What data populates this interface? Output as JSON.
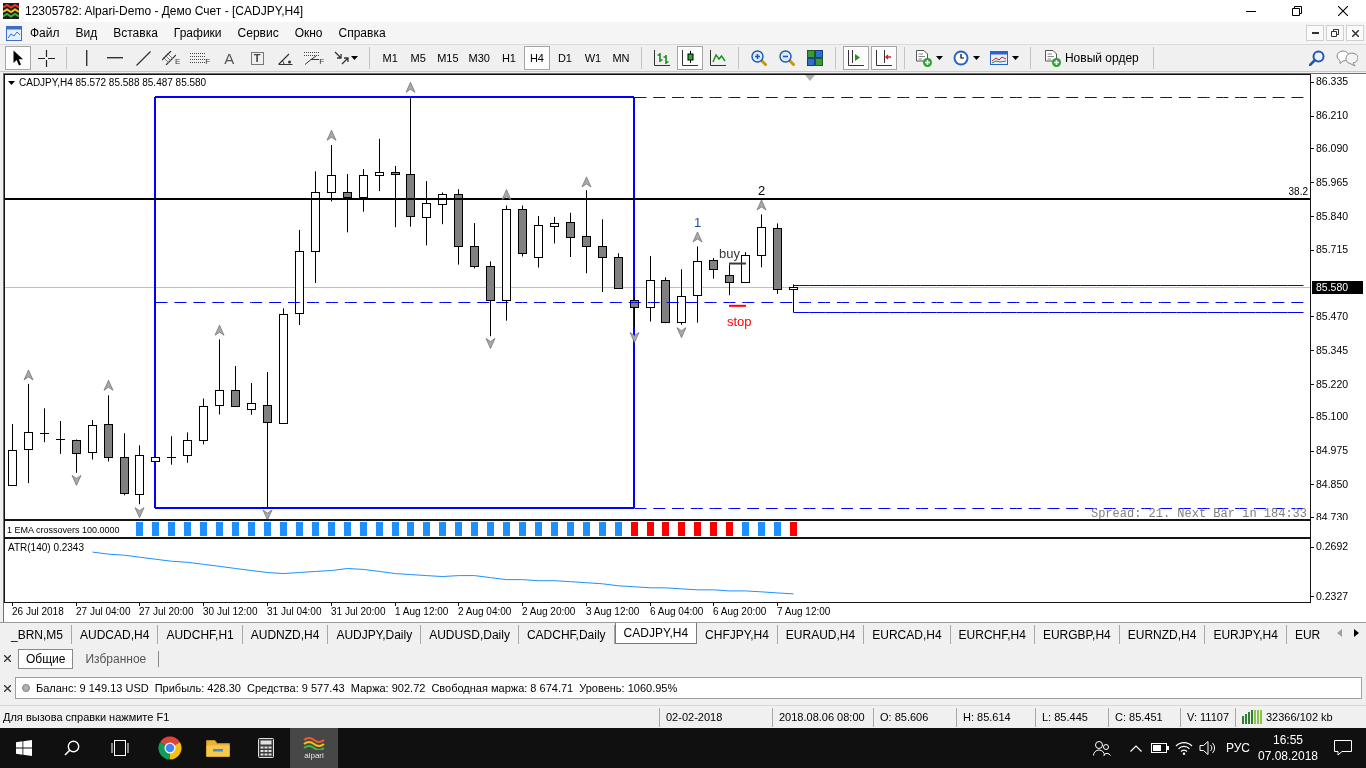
{
  "window": {
    "title": "12305782: Alpari-Demo - Демо Счет - [CADJPY,H4]"
  },
  "menu": [
    "Файл",
    "Вид",
    "Вставка",
    "Графики",
    "Сервис",
    "Окно",
    "Справка"
  ],
  "toolbar": {
    "draw_tools": [
      {
        "kind": "cursor",
        "selected": true
      },
      {
        "kind": "crosshair",
        "selected": false
      },
      {
        "kind": "vline",
        "selected": false
      },
      {
        "kind": "hline",
        "selected": false
      },
      {
        "kind": "trendline",
        "selected": false
      },
      {
        "kind": "channel",
        "glyph": "E",
        "selected": false
      },
      {
        "kind": "fibo",
        "glyph": "F",
        "selected": false
      },
      {
        "kind": "text",
        "glyph": "A",
        "selected": false
      },
      {
        "kind": "label",
        "glyph": "T",
        "selected": false
      },
      {
        "kind": "angle",
        "selected": false
      },
      {
        "kind": "fan",
        "glyph": "F",
        "selected": false
      },
      {
        "kind": "arrows",
        "selected": false
      }
    ],
    "timeframes": [
      {
        "label": "M1",
        "selected": false
      },
      {
        "label": "M5",
        "selected": false
      },
      {
        "label": "M15",
        "selected": false
      },
      {
        "label": "M30",
        "selected": false
      },
      {
        "label": "H1",
        "selected": false
      },
      {
        "label": "H4",
        "selected": true
      },
      {
        "label": "D1",
        "selected": false
      },
      {
        "label": "W1",
        "selected": false
      },
      {
        "label": "MN",
        "selected": false
      }
    ],
    "chart_types": [
      {
        "kind": "bars",
        "selected": false
      },
      {
        "kind": "candles",
        "selected": true
      },
      {
        "kind": "line",
        "selected": false
      }
    ],
    "view_tools": [
      {
        "kind": "zoom-in"
      },
      {
        "kind": "zoom-out"
      },
      {
        "kind": "tile"
      }
    ],
    "toggles": [
      {
        "kind": "autoscroll",
        "on": true
      },
      {
        "kind": "shift",
        "on": true
      }
    ],
    "menus": [
      {
        "kind": "indicators"
      },
      {
        "kind": "periods"
      },
      {
        "kind": "templates"
      }
    ],
    "new_order": "Новый ордер"
  },
  "chart": {
    "title": "CADJPY,H4 85.572 85.588 85.487 85.580",
    "chart_data": [
      {
        "type": "candlestick",
        "categories": [
          null,
          null,
          null,
          null,
          null,
          null,
          null,
          null,
          null,
          null,
          null,
          null,
          null,
          null,
          null,
          null,
          null,
          null,
          null,
          null,
          null,
          null,
          null,
          null,
          null,
          null,
          null,
          null,
          null,
          null,
          null,
          null,
          null,
          null,
          null,
          null,
          null,
          null,
          null,
          null,
          null,
          null,
          null,
          null,
          null,
          null,
          null,
          null,
          null,
          null,
          null,
          null,
          null,
          null,
          null,
          null,
          null,
          null,
          null,
          null,
          null,
          null,
          null,
          null,
          null,
          null,
          null,
          null,
          null,
          null,
          null,
          null,
          null,
          null,
          null,
          null,
          null,
          null,
          null,
          null,
          null,
          null
        ],
        "ohlc": [
          [
            84.848,
            85.073,
            84.845,
            84.976
          ],
          [
            84.98,
            85.221,
            84.855,
            85.042
          ],
          [
            85.038,
            85.131,
            85.006,
            85.04
          ],
          [
            85.018,
            85.084,
            84.963,
            85.018
          ],
          [
            85.013,
            85.016,
            84.893,
            84.965
          ],
          [
            84.968,
            85.088,
            84.942,
            85.069
          ],
          [
            85.072,
            85.179,
            84.935,
            84.95
          ],
          [
            84.95,
            85.039,
            84.81,
            84.817
          ],
          [
            84.814,
            84.994,
            84.777,
            84.96
          ],
          [
            84.936,
            84.953,
            84.936,
            84.953
          ],
          [
            84.949,
            85.028,
            84.923,
            84.951
          ],
          [
            84.957,
            85.042,
            84.93,
            85.013
          ],
          [
            85.013,
            85.167,
            84.998,
            85.141
          ],
          [
            85.144,
            85.385,
            85.108,
            85.197
          ],
          [
            85.197,
            85.287,
            85.138,
            85.138
          ],
          [
            85.129,
            85.224,
            85.107,
            85.149
          ],
          [
            85.144,
            85.265,
            84.765,
            85.079
          ],
          [
            85.078,
            85.5,
            85.073,
            85.48
          ],
          [
            85.483,
            85.789,
            85.438,
            85.71
          ],
          [
            85.71,
            86.005,
            85.593,
            85.927
          ],
          [
            85.929,
            86.102,
            85.894,
            85.992
          ],
          [
            85.927,
            85.995,
            85.78,
            85.909
          ],
          [
            85.909,
            86.013,
            85.856,
            85.991
          ],
          [
            85.991,
            86.125,
            85.932,
            86.003
          ],
          [
            86.003,
            86.025,
            85.799,
            85.995
          ],
          [
            85.995,
            86.275,
            85.801,
            85.84
          ],
          [
            85.835,
            85.969,
            85.732,
            85.887
          ],
          [
            85.885,
            85.927,
            85.81,
            85.921
          ],
          [
            85.92,
            85.939,
            85.661,
            85.728
          ],
          [
            85.728,
            85.814,
            85.647,
            85.656
          ],
          [
            85.656,
            85.673,
            85.397,
            85.531
          ],
          [
            85.531,
            85.879,
            85.454,
            85.866
          ],
          [
            85.866,
            85.879,
            85.691,
            85.703
          ],
          [
            85.689,
            85.84,
            85.65,
            85.807
          ],
          [
            85.804,
            85.837,
            85.739,
            85.813
          ],
          [
            85.817,
            85.852,
            85.689,
            85.763
          ],
          [
            85.766,
            85.935,
            85.629,
            85.728
          ],
          [
            85.728,
            85.828,
            85.56,
            85.688
          ],
          [
            85.688,
            85.703,
            85.573,
            85.576
          ],
          [
            85.53,
            85.54,
            85.431,
            85.505
          ],
          [
            85.504,
            85.693,
            85.451,
            85.606
          ],
          [
            85.606,
            85.614,
            85.445,
            85.451
          ],
          [
            85.451,
            85.644,
            85.439,
            85.544
          ],
          [
            85.549,
            85.728,
            85.447,
            85.676
          ],
          [
            85.679,
            85.685,
            85.609,
            85.646
          ],
          [
            85.623,
            85.662,
            85.548,
            85.597
          ],
          [
            85.597,
            85.707,
            85.593,
            85.697
          ],
          [
            85.697,
            85.846,
            85.651,
            85.799
          ],
          [
            85.795,
            85.813,
            85.553,
            85.57
          ],
          [
            85.572,
            85.588,
            85.487,
            85.58
          ],
          null,
          null,
          null,
          null,
          null,
          null,
          null,
          null,
          null,
          null,
          null,
          null,
          null,
          null,
          null,
          null,
          null,
          null,
          null,
          null,
          null,
          null,
          null,
          null,
          null,
          null,
          null,
          null,
          null,
          null,
          null,
          null
        ],
        "series": [
          {
            "type": "scatter",
            "marker": "diamond",
            "color": "#a9a9a9",
            "values": [
              null,
              85.254,
              null,
              null,
              null,
              null,
              85.216,
              null,
              null,
              null,
              null,
              null,
              null,
              85.419,
              null,
              null,
              null,
              null,
              null,
              null,
              86.138,
              null,
              null,
              null,
              null,
              86.315,
              null,
              null,
              null,
              null,
              null,
              85.919,
              null,
              null,
              null,
              null,
              85.966,
              null,
              null,
              null,
              null,
              null,
              null,
              85.763,
              null,
              null,
              null,
              85.881,
              null,
              null,
              null,
              null,
              null,
              null,
              null,
              null,
              null,
              null,
              null,
              null,
              null,
              null,
              null,
              null,
              null,
              null,
              null,
              null,
              null,
              null,
              null,
              null,
              null,
              null,
              null,
              null,
              null,
              null,
              null,
              null,
              null,
              null
            ]
          },
          {
            "type": "scatter",
            "marker": "diamond",
            "color": "#a9a9a9",
            "values": [
              null,
              null,
              null,
              null,
              84.865,
              null,
              null,
              null,
              84.746,
              null,
              null,
              null,
              null,
              null,
              null,
              null,
              84.737,
              null,
              null,
              null,
              null,
              null,
              null,
              null,
              null,
              null,
              null,
              null,
              null,
              null,
              85.37,
              null,
              null,
              null,
              null,
              null,
              null,
              null,
              null,
              85.392,
              null,
              null,
              85.41,
              null,
              null,
              null,
              null,
              null,
              null,
              null,
              null,
              null,
              null,
              null,
              null,
              null,
              null,
              null,
              null,
              null,
              null,
              null,
              null,
              null,
              null,
              null,
              null,
              null,
              null,
              null,
              null,
              null,
              null,
              null,
              null,
              null,
              null,
              null,
              null,
              null,
              null,
              null
            ]
          },
          {
            "type": "line",
            "color": "#0000ff",
            "values": [
              null,
              null,
              null,
              null,
              null,
              null,
              null,
              null,
              null,
              86.28,
              86.28,
              86.28,
              86.28,
              86.28,
              86.28,
              86.28,
              86.28,
              86.28,
              86.28,
              86.28,
              86.28,
              86.28,
              86.28,
              86.28,
              86.28,
              86.28,
              86.28,
              86.28,
              86.28,
              86.28,
              86.28,
              86.28,
              86.28,
              86.28,
              86.28,
              86.28,
              86.28,
              86.28,
              86.28,
              86.28,
              null,
              null,
              null,
              null,
              null,
              null,
              null,
              null,
              null,
              null,
              null,
              null,
              null,
              null,
              null,
              null,
              null,
              null,
              null,
              null,
              null,
              null,
              null,
              null,
              null,
              null,
              null,
              null,
              null,
              null,
              null,
              null,
              null,
              null,
              null,
              null,
              null,
              null,
              null,
              null,
              null,
              null
            ]
          },
          {
            "type": "line",
            "color": "#0000ff",
            "values": [
              null,
              null,
              null,
              null,
              null,
              null,
              null,
              null,
              null,
              84.762,
              84.762,
              84.762,
              84.762,
              84.762,
              84.762,
              84.762,
              84.762,
              84.762,
              84.762,
              84.762,
              84.762,
              84.762,
              84.762,
              84.762,
              84.762,
              84.762,
              84.762,
              84.762,
              84.762,
              84.762,
              84.762,
              84.762,
              84.762,
              84.762,
              84.762,
              84.762,
              84.762,
              84.762,
              84.762,
              84.762,
              null,
              null,
              null,
              null,
              null,
              null,
              null,
              null,
              null,
              null,
              null,
              null,
              null,
              null,
              null,
              null,
              null,
              null,
              null,
              null,
              null,
              null,
              null,
              null,
              null,
              null,
              null,
              null,
              null,
              null,
              null,
              null,
              null,
              null,
              null,
              null,
              null,
              null,
              null,
              null,
              null,
              null
            ]
          },
          {
            "type": "line",
            "color": "#0000ff",
            "line_style": "dashed",
            "values": [
              null,
              null,
              null,
              null,
              null,
              null,
              null,
              null,
              null,
              null,
              null,
              null,
              null,
              null,
              null,
              null,
              null,
              null,
              null,
              null,
              null,
              null,
              null,
              null,
              null,
              null,
              null,
              null,
              null,
              null,
              null,
              null,
              null,
              null,
              null,
              null,
              null,
              null,
              null,
              86.28,
              86.28,
              86.28,
              86.28,
              86.28,
              86.28,
              86.28,
              86.28,
              86.28,
              86.28,
              86.28,
              86.28,
              86.28,
              86.28,
              86.28,
              86.28,
              86.28,
              86.28,
              86.28,
              86.28,
              86.28,
              86.28,
              86.28,
              86.28,
              86.28,
              86.28,
              86.28,
              86.28,
              86.28,
              86.28,
              86.28,
              86.28,
              86.28,
              86.28,
              86.28,
              86.28,
              86.28,
              86.28,
              86.28,
              86.28,
              86.28,
              86.28,
              86.28
            ]
          },
          {
            "type": "line",
            "color": "#0000ff",
            "line_style": "dashed",
            "values": [
              null,
              null,
              null,
              null,
              null,
              null,
              null,
              null,
              null,
              85.522,
              85.522,
              85.522,
              85.522,
              85.522,
              85.522,
              85.522,
              85.522,
              85.522,
              85.522,
              85.522,
              85.522,
              85.522,
              85.522,
              85.522,
              85.522,
              85.522,
              85.522,
              85.522,
              85.522,
              85.522,
              85.522,
              85.522,
              85.522,
              85.522,
              85.522,
              85.522,
              85.522,
              85.522,
              85.522,
              85.522,
              85.522,
              85.522,
              85.522,
              85.522,
              85.522,
              85.522,
              85.522,
              85.522,
              85.522,
              85.522,
              85.522,
              85.522,
              85.522,
              85.522,
              85.522,
              85.522,
              85.522,
              85.522,
              85.522,
              85.522,
              85.522,
              85.522,
              85.522,
              85.522,
              85.522,
              85.522,
              85.522,
              85.522,
              85.522,
              85.522,
              85.522,
              85.522,
              85.522,
              85.522,
              85.522,
              85.522,
              85.522,
              85.522,
              85.522,
              85.522,
              85.522,
              85.522
            ]
          },
          {
            "type": "line",
            "color": "#0000ff",
            "line_style": "dashed",
            "values": [
              null,
              null,
              null,
              null,
              null,
              null,
              null,
              null,
              null,
              null,
              null,
              null,
              null,
              null,
              null,
              null,
              null,
              null,
              null,
              null,
              null,
              null,
              null,
              null,
              null,
              null,
              null,
              null,
              null,
              null,
              null,
              null,
              null,
              null,
              null,
              null,
              null,
              null,
              null,
              84.762,
              84.762,
              84.762,
              84.762,
              84.762,
              84.762,
              84.762,
              84.762,
              84.762,
              84.762,
              84.762,
              84.762,
              84.762,
              84.762,
              84.762,
              84.762,
              84.762,
              84.762,
              84.762,
              84.762,
              84.762,
              84.762,
              84.762,
              84.762,
              84.762,
              84.762,
              84.762,
              84.762,
              84.762,
              84.762,
              84.762,
              84.762,
              84.762,
              84.762,
              84.762,
              84.762,
              84.762,
              84.762,
              84.762,
              84.762,
              84.762,
              84.762,
              84.762
            ]
          },
          {
            "type": "line",
            "color": "#0000ff",
            "values": [
              null,
              null,
              null,
              null,
              null,
              null,
              null,
              null,
              null,
              null,
              null,
              null,
              null,
              null,
              null,
              null,
              null,
              null,
              null,
              null,
              null,
              null,
              null,
              null,
              null,
              null,
              null,
              null,
              null,
              null,
              null,
              null,
              null,
              null,
              null,
              null,
              null,
              null,
              null,
              null,
              null,
              null,
              null,
              null,
              null,
              null,
              null,
              null,
              null,
              85.584,
              85.584,
              85.584,
              85.584,
              85.584,
              85.584,
              85.584,
              85.584,
              85.584,
              85.584,
              85.584,
              85.584,
              85.584,
              85.584,
              85.584,
              85.584,
              85.584,
              85.584,
              85.584,
              85.584,
              85.584,
              85.584,
              85.584,
              85.584,
              85.584,
              85.584,
              85.584,
              85.584,
              85.584,
              85.584,
              85.584,
              85.584,
              85.584
            ]
          },
          {
            "type": "line",
            "color": "#0000ff",
            "values": [
              null,
              null,
              null,
              null,
              null,
              null,
              null,
              null,
              null,
              null,
              null,
              null,
              null,
              null,
              null,
              null,
              null,
              null,
              null,
              null,
              null,
              null,
              null,
              null,
              null,
              null,
              null,
              null,
              null,
              null,
              null,
              null,
              null,
              null,
              null,
              null,
              null,
              null,
              null,
              null,
              null,
              null,
              null,
              null,
              null,
              null,
              null,
              null,
              null,
              85.486,
              85.486,
              85.486,
              85.486,
              85.486,
              85.486,
              85.486,
              85.486,
              85.486,
              85.486,
              85.486,
              85.486,
              85.486,
              85.486,
              85.486,
              85.486,
              85.486,
              85.486,
              85.486,
              85.486,
              85.486,
              85.486,
              85.486,
              85.486,
              85.486,
              85.486,
              85.486,
              85.486,
              85.486,
              85.486,
              85.486,
              85.486,
              85.486
            ]
          },
          {
            "name": "buy",
            "type": "line",
            "color": "#3a3a3a",
            "values": [
              null,
              null,
              null,
              null,
              null,
              null,
              null,
              null,
              null,
              null,
              null,
              null,
              null,
              null,
              null,
              null,
              null,
              null,
              null,
              null,
              null,
              null,
              null,
              null,
              null,
              null,
              null,
              null,
              null,
              null,
              null,
              null,
              null,
              null,
              null,
              null,
              null,
              null,
              null,
              null,
              null,
              null,
              null,
              null,
              null,
              85.665,
              85.665,
              null,
              null,
              null,
              null,
              null,
              null,
              null,
              null,
              null,
              null,
              null,
              null,
              null,
              null,
              null,
              null,
              null,
              null,
              null,
              null,
              null,
              null,
              null,
              null,
              null,
              null,
              null,
              null,
              null,
              null,
              null,
              null,
              null,
              null,
              null
            ]
          },
          {
            "name": "stop",
            "type": "line",
            "color": "#ff0000",
            "values": [
              null,
              null,
              null,
              null,
              null,
              null,
              null,
              null,
              null,
              null,
              null,
              null,
              null,
              null,
              null,
              null,
              null,
              null,
              null,
              null,
              null,
              null,
              null,
              null,
              null,
              null,
              null,
              null,
              null,
              null,
              null,
              null,
              null,
              null,
              null,
              null,
              null,
              null,
              null,
              null,
              null,
              null,
              null,
              null,
              null,
              85.509,
              85.509,
              null,
              null,
              null,
              null,
              null,
              null,
              null,
              null,
              null,
              null,
              null,
              null,
              null,
              null,
              null,
              null,
              null,
              null,
              null,
              null,
              null,
              null,
              null,
              null,
              null,
              null,
              null,
              null,
              null,
              null,
              null,
              null,
              null,
              null,
              null
            ]
          }
        ],
        "ylim": [
          84.719,
          86.364
        ],
        "yticks": [
          86.335,
          {
            "value": 86.21,
            "label": "86.210"
          },
          {
            "value": 86.09,
            "label": "86.090"
          },
          85.965,
          {
            "value": 85.84,
            "label": "85.840"
          },
          85.715,
          {
            "value": 85.47,
            "label": "85.470"
          },
          85.345,
          {
            "value": 85.22,
            "label": "85.220"
          },
          {
            "value": 85.1,
            "label": "85.100"
          },
          84.975,
          {
            "value": 84.85,
            "label": "84.850"
          },
          {
            "value": 84.73,
            "label": "84.730"
          }
        ],
        "ref_lines": [
          {
            "axis": "y",
            "value": 85.58,
            "label": "85.580",
            "color": "#c0c0c0",
            "line_style": "solid"
          },
          {
            "axis": "y",
            "value": 85.904,
            "color": "#000000",
            "line_style": "solid"
          }
        ],
        "annotations": [
          "38.2",
          "1",
          "2",
          "Spread: 21. Next Bar in 184:33"
        ]
      },
      {
        "type": "line",
        "title": "ATR(140) 0.2343",
        "color": "#1e90ff",
        "ylim": [
          0.2275,
          0.2759
        ],
        "yticks": [
          0.2692,
          0.2327
        ],
        "categories": [
          null,
          null,
          null,
          null,
          null,
          null,
          null,
          null,
          null,
          null,
          null,
          null,
          null,
          null,
          null,
          null,
          null,
          null,
          null,
          null,
          null,
          null,
          null,
          null,
          null,
          null,
          null,
          null,
          null,
          null,
          null,
          null,
          null,
          null,
          null,
          null,
          null,
          null,
          null,
          null,
          null,
          null,
          null,
          null,
          null,
          null,
          null,
          null,
          null,
          null,
          null,
          null,
          null,
          null,
          null,
          null,
          null,
          null,
          null,
          null,
          null,
          null,
          null,
          null,
          null,
          null,
          null,
          null,
          null,
          null,
          null,
          null,
          null,
          null,
          null,
          null,
          null,
          null,
          null,
          null,
          null,
          null
        ],
        "values": [
          null,
          null,
          null,
          null,
          null,
          0.2654,
          0.2639,
          0.2631,
          0.2616,
          0.2601,
          0.2586,
          0.2578,
          0.2563,
          0.2548,
          0.2532,
          0.2517,
          0.2502,
          0.2494,
          0.2502,
          0.251,
          0.2517,
          0.2532,
          0.2525,
          0.251,
          0.2494,
          0.2487,
          0.2479,
          0.2472,
          0.2479,
          0.2479,
          0.2464,
          0.2449,
          0.2449,
          0.2441,
          0.2441,
          0.2434,
          0.2426,
          0.2418,
          0.2403,
          0.2396,
          0.2388,
          0.2388,
          0.238,
          0.2373,
          0.2373,
          0.2365,
          0.2365,
          0.2358,
          0.235,
          0.2343,
          null,
          null,
          null,
          null,
          null,
          null,
          null,
          null,
          null,
          null,
          null,
          null,
          null,
          null,
          null,
          null,
          null,
          null,
          null,
          null,
          null,
          null,
          null,
          null,
          null,
          null,
          null,
          null,
          null,
          null,
          null,
          null
        ]
      }
    ],
    "indicator_strip": {
      "title": "1 EMA crossovers 100.0000",
      "bars": [
        {
          "color": "#1e90ff"
        },
        {
          "color": "#1e90ff"
        },
        {
          "color": "#1e90ff"
        },
        {
          "color": "#1e90ff"
        },
        {
          "color": "#1e90ff"
        },
        {
          "color": "#1e90ff"
        },
        {
          "color": "#1e90ff"
        },
        {
          "color": "#1e90ff"
        },
        {
          "color": "#1e90ff"
        },
        {
          "color": "#1e90ff"
        },
        {
          "color": "#1e90ff"
        },
        {
          "color": "#1e90ff"
        },
        {
          "color": "#1e90ff"
        },
        {
          "color": "#1e90ff"
        },
        {
          "color": "#1e90ff"
        },
        {
          "color": "#1e90ff"
        },
        {
          "color": "#1e90ff"
        },
        {
          "color": "#1e90ff"
        },
        {
          "color": "#1e90ff"
        },
        {
          "color": "#1e90ff"
        },
        {
          "color": "#1e90ff"
        },
        {
          "color": "#1e90ff"
        },
        {
          "color": "#1e90ff"
        },
        {
          "color": "#1e90ff"
        },
        {
          "color": "#1e90ff"
        },
        {
          "color": "#1e90ff"
        },
        {
          "color": "#1e90ff"
        },
        {
          "color": "#1e90ff"
        },
        {
          "color": "#1e90ff"
        },
        {
          "color": "#1e90ff"
        },
        {
          "color": "#1e90ff"
        },
        {
          "color": "#ff0000"
        },
        {
          "color": "#ff0000"
        },
        {
          "color": "#ff0000"
        },
        {
          "color": "#ff0000"
        },
        {
          "color": "#ff0000"
        },
        {
          "color": "#ff0000"
        },
        {
          "color": "#ff0000"
        },
        {
          "color": "#1e90ff"
        },
        {
          "color": "#1e90ff"
        },
        {
          "color": "#1e90ff"
        },
        {
          "color": "#ff0000"
        }
      ]
    },
    "time_axis": [
      "26 Jul 2018",
      "27 Jul 04:00",
      "27 Jul 20:00",
      "30 Jul 12:00",
      "31 Jul 04:00",
      "31 Jul 20:00",
      "1 Aug 12:00",
      "2 Aug 04:00",
      "2 Aug 20:00",
      "3 Aug 12:00",
      "6 Aug 04:00",
      "6 Aug 20:00",
      "7 Aug 12:00"
    ]
  },
  "tabs": [
    {
      "label": "_BRN,M5",
      "selected": false
    },
    {
      "label": "AUDCAD,H4",
      "selected": false
    },
    {
      "label": "AUDCHF,H1",
      "selected": false
    },
    {
      "label": "AUDNZD,H4",
      "selected": false
    },
    {
      "label": "AUDJPY,Daily",
      "selected": false
    },
    {
      "label": "AUDUSD,Daily",
      "selected": false
    },
    {
      "label": "CADCHF,Daily",
      "selected": false
    },
    {
      "label": "CADJPY,H4",
      "selected": true
    },
    {
      "label": "CHFJPY,H4",
      "selected": false
    },
    {
      "label": "EURAUD,H4",
      "selected": false
    },
    {
      "label": "EURCAD,H4",
      "selected": false
    },
    {
      "label": "EURCHF,H4",
      "selected": false
    },
    {
      "label": "EURGBP,H4",
      "selected": false
    },
    {
      "label": "EURNZD,H4",
      "selected": false
    },
    {
      "label": "EURJPY,H4",
      "selected": false
    },
    {
      "label": "EUR",
      "selected": false
    }
  ],
  "terminal": {
    "tabs": [
      {
        "label": "Общие",
        "selected": true
      },
      {
        "label": "Избранное",
        "selected": false
      }
    ],
    "account": [
      "Баланс: 9 149.13 USD",
      "Прибыль: 428.30",
      "Средства: 9 577.43",
      "Маржа: 902.72",
      "Свободная маржа: 8 674.71",
      "Уровень: 1060.95%"
    ]
  },
  "status_bar": {
    "help": "Для вызова справки нажмите F1",
    "profile": "02-02-2018",
    "bar_time": "2018.08.06 08:00",
    "open": "O: 85.606",
    "high": "H: 85.614",
    "low": "L: 85.445",
    "close": "C: 85.451",
    "volume": "V: 11107",
    "traffic": "32366/102 kb"
  },
  "taskbar": {
    "apps": [
      {
        "kind": "browser",
        "selected": false
      },
      {
        "kind": "folder",
        "selected": false
      },
      {
        "kind": "calculator",
        "selected": false
      },
      {
        "kind": "trading",
        "label": "alpari",
        "selected": true
      }
    ],
    "language": "РУС",
    "time": "16:55",
    "date": "07.08.2018"
  }
}
